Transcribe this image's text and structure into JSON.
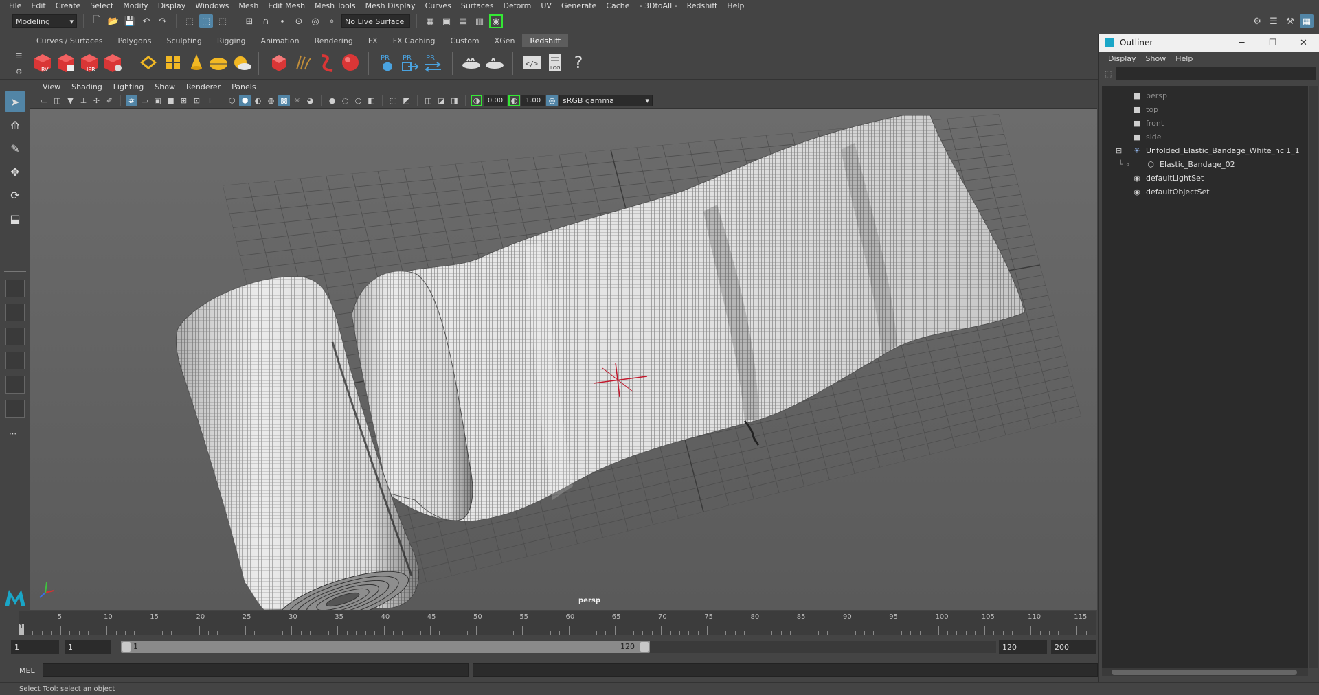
{
  "menubar": {
    "items": [
      "File",
      "Edit",
      "Create",
      "Select",
      "Modify",
      "Display",
      "Windows",
      "Mesh",
      "Edit Mesh",
      "Mesh Tools",
      "Mesh Display",
      "Curves",
      "Surfaces",
      "Deform",
      "UV",
      "Generate",
      "Cache",
      "- 3DtoAll -",
      "Redshift",
      "Help"
    ]
  },
  "statusline": {
    "menuset": "Modeling",
    "live_surface": "No Live Surface"
  },
  "shelf": {
    "tabs": [
      "Curves / Surfaces",
      "Polygons",
      "Sculpting",
      "Rigging",
      "Animation",
      "Rendering",
      "FX",
      "FX Caching",
      "Custom",
      "XGen",
      "Redshift"
    ],
    "active_tab": "Redshift",
    "icon_labels": {
      "rv": "RV",
      "ipr": "IPR",
      "pr1": "PR",
      "pr2": "PR",
      "pr3": "PR",
      "log": "LOG"
    }
  },
  "panel": {
    "menus": [
      "View",
      "Shading",
      "Lighting",
      "Show",
      "Renderer",
      "Panels"
    ],
    "exposure": "0.00",
    "gamma": "1.00",
    "color_space": "sRGB gamma",
    "camera_label": "persp"
  },
  "timeline": {
    "labels": [
      "5",
      "10",
      "15",
      "20",
      "25",
      "30",
      "35",
      "40",
      "45",
      "50",
      "55",
      "60",
      "65",
      "70",
      "75",
      "80",
      "85",
      "90",
      "95",
      "100",
      "105",
      "110",
      "115"
    ],
    "current_frame": "1"
  },
  "range": {
    "start_time": "1",
    "playback_start": "1",
    "range_start_label": "1",
    "range_end_label": "120",
    "playback_end": "120",
    "end_time": "200"
  },
  "cmdline": {
    "label": "MEL"
  },
  "helpline": {
    "text": "Select Tool: select an object"
  },
  "outliner": {
    "title": "Outliner",
    "menus": [
      "Display",
      "Show",
      "Help"
    ],
    "items": [
      {
        "label": "persp",
        "icon": "camera-icon",
        "indent": 1,
        "dim": true
      },
      {
        "label": "top",
        "icon": "camera-icon",
        "indent": 1,
        "dim": true
      },
      {
        "label": "front",
        "icon": "camera-icon",
        "indent": 1,
        "dim": true
      },
      {
        "label": "side",
        "icon": "camera-icon",
        "indent": 1,
        "dim": true
      },
      {
        "label": "Unfolded_Elastic_Bandage_White_ncl1_1",
        "icon": "group-icon",
        "indent": 1,
        "dim": false
      },
      {
        "label": "Elastic_Bandage_02",
        "icon": "mesh-icon",
        "indent": 2,
        "dim": false
      },
      {
        "label": "defaultLightSet",
        "icon": "set-icon",
        "indent": 1,
        "dim": false
      },
      {
        "label": "defaultObjectSet",
        "icon": "set-icon",
        "indent": 1,
        "dim": false
      }
    ]
  },
  "colors": {
    "accent": "#5285a6",
    "highlight_green": "#34e834",
    "redshift_red": "#e23a3a"
  }
}
